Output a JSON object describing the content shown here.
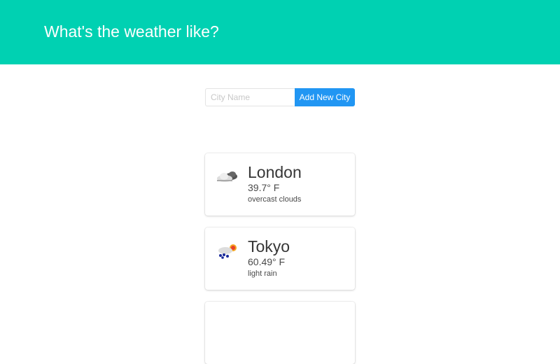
{
  "header": {
    "title": "What's the weather like?",
    "color": "#00d1b2"
  },
  "form": {
    "placeholder": "City Name",
    "button_label": "Add New City",
    "button_color": "#2196f3"
  },
  "cities": [
    {
      "name": "London",
      "temp": "39.7° F",
      "description": "overcast clouds",
      "icon": "overcast-clouds-icon"
    },
    {
      "name": "Tokyo",
      "temp": "60.49° F",
      "description": "light rain",
      "icon": "light-rain-sun-icon"
    }
  ]
}
